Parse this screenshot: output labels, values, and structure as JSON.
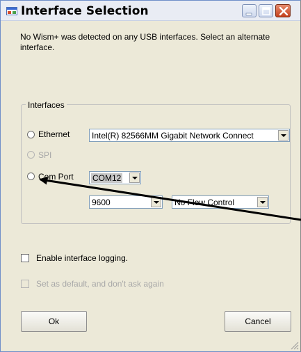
{
  "window": {
    "title": "Interface Selection"
  },
  "message": "No Wism+ was detected on any USB interfaces. Select an alternate interface.",
  "interfaces_group": {
    "label": "Interfaces",
    "ethernet": {
      "label": "Ethernet",
      "adapter_value": "Intel(R) 82566MM Gigabit Network Connect"
    },
    "spi": {
      "label": "SPI",
      "enabled": false
    },
    "com_port": {
      "label": "Com Port",
      "port_value": "COM12",
      "baud_value": "9600",
      "flow_control_value": "No Flow Control"
    }
  },
  "options": {
    "logging_label": "Enable interface logging.",
    "default_label": "Set as default, and don't ask again",
    "default_enabled": false
  },
  "buttons": {
    "ok_label": "Ok",
    "cancel_label": "Cancel"
  },
  "icons": {
    "app": "window-app-icon",
    "minimize": "minimize-icon",
    "maximize": "maximize-icon",
    "close": "close-icon",
    "resize": "resize-grip-icon"
  },
  "colors": {
    "window_bg": "#ece9d8",
    "close_button": "#c4401c",
    "combo_border": "#7f9db9"
  }
}
